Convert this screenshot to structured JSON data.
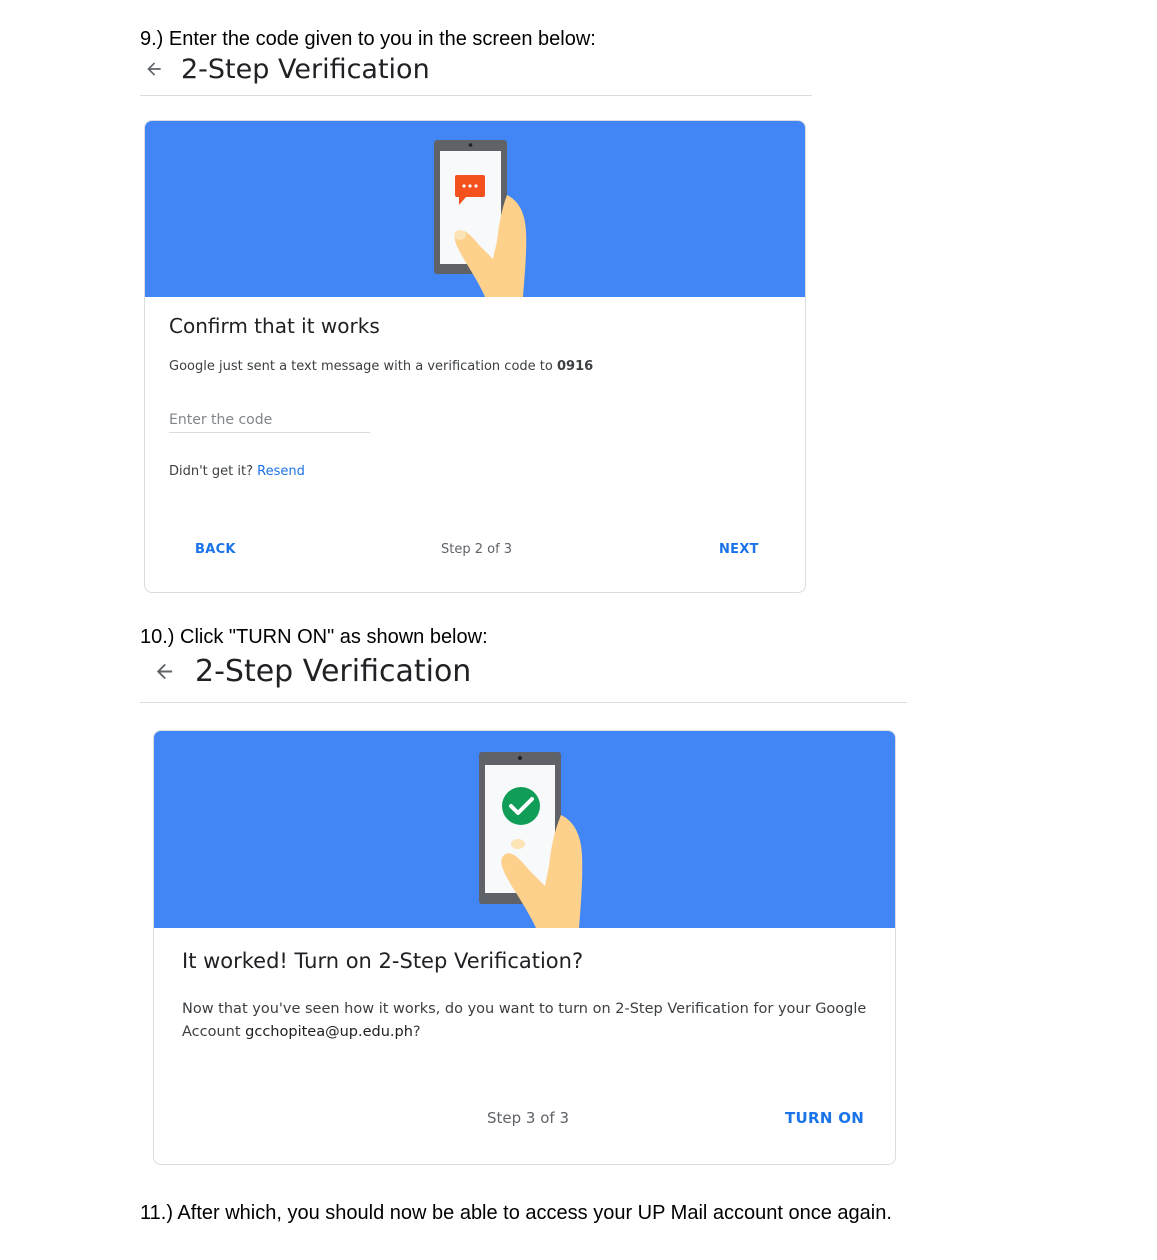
{
  "instructions": {
    "step9": "9.) Enter the code given to you in the screen below:",
    "step10": "10.) Click \"TURN ON\" as shown below:",
    "step11": "11.) After which, you should now be able to access your UP Mail account once again."
  },
  "screen1": {
    "header_title": "2-Step Verification",
    "card_title": "Confirm that it works",
    "message_prefix": "Google just sent a text message with a verification code to ",
    "phone_suffix": "0916",
    "code_placeholder": "Enter the code",
    "didnt_get": "Didn't get it?",
    "resend_label": "Resend",
    "back_label": "BACK",
    "step_label": "Step 2 of 3",
    "next_label": "NEXT"
  },
  "screen2": {
    "header_title": "2-Step Verification",
    "card_title": "It worked! Turn on 2-Step Verification?",
    "body_line1": "Now that you've seen how it works, do you want to turn on 2-Step Verification for your Google",
    "body_prefix2": "Account ",
    "account_email": "gcchopitea@up.edu.ph",
    "body_suffix2": "?",
    "step_label": "Step 3 of 3",
    "turn_on_label": "TURN ON"
  },
  "colors": {
    "banner_blue": "#4285f4",
    "link_blue": "#1a73e8",
    "message_orange": "#f4511e",
    "check_green": "#0f9d58",
    "skin": "#fdd08b"
  },
  "icons": {
    "back": "arrow-left-icon",
    "message": "chat-bubble-icon",
    "check": "check-circle-icon"
  }
}
